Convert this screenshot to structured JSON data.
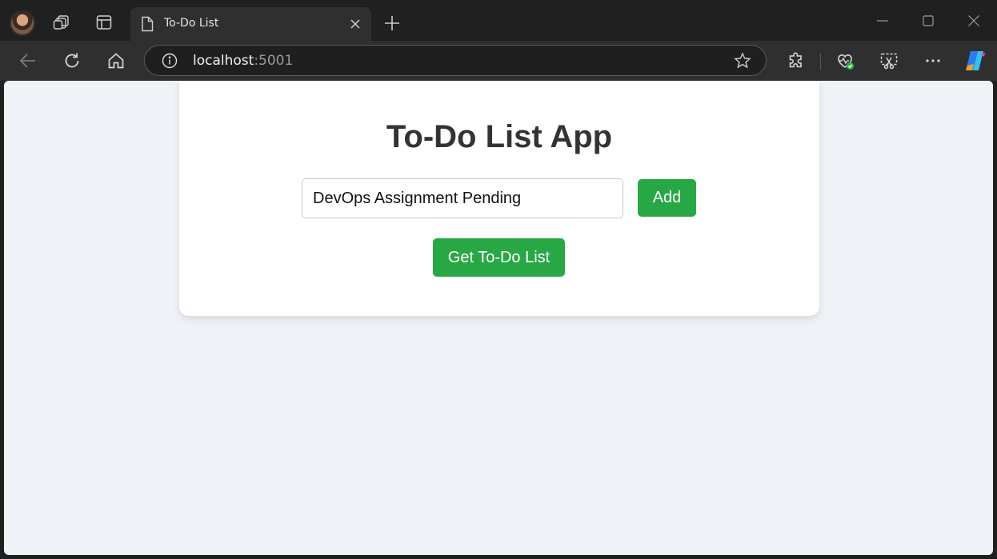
{
  "browser": {
    "tab": {
      "title": "To-Do List"
    },
    "address": {
      "host": "localhost",
      "port": ":5001"
    }
  },
  "app": {
    "title": "To-Do List App",
    "task_input": {
      "value": "DevOps Assignment Pending"
    },
    "add_label": "Add",
    "get_list_label": "Get To-Do List"
  },
  "colors": {
    "accent": "#28a745",
    "page_background": "#eff2f7",
    "card_background": "#ffffff",
    "title_text": "#333333"
  }
}
